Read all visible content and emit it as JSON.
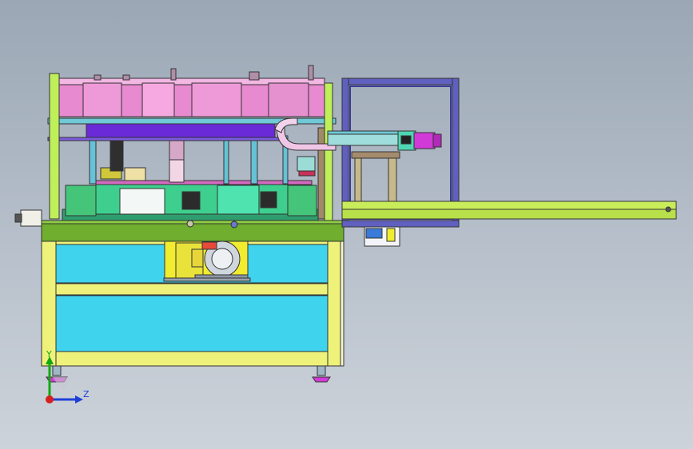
{
  "viewport": {
    "background_top": "#9ba7b5",
    "background_bottom": "#cdd3da"
  },
  "triad": {
    "y_label": "Y",
    "z_label": "Z",
    "y_color": "#12a812",
    "z_color": "#1f3fd8",
    "x_color": "#d81f1f"
  },
  "colors": {
    "frame_yellow": "#eef27a",
    "panel_cyan": "#3fd3ee",
    "base_green": "#6fae2e",
    "carousel_pink": "#e88ad0",
    "beam_purple": "#6a2ad8",
    "rail_green": "#c9ec5a",
    "post_green": "#bff05a",
    "magenta_motor": "#d23ad8",
    "navy_frame": "#3a3a9a",
    "khaki_stand": "#c8b98a"
  },
  "icons": {
    "motor": "motor-icon",
    "axis": "axis-triad-icon"
  }
}
